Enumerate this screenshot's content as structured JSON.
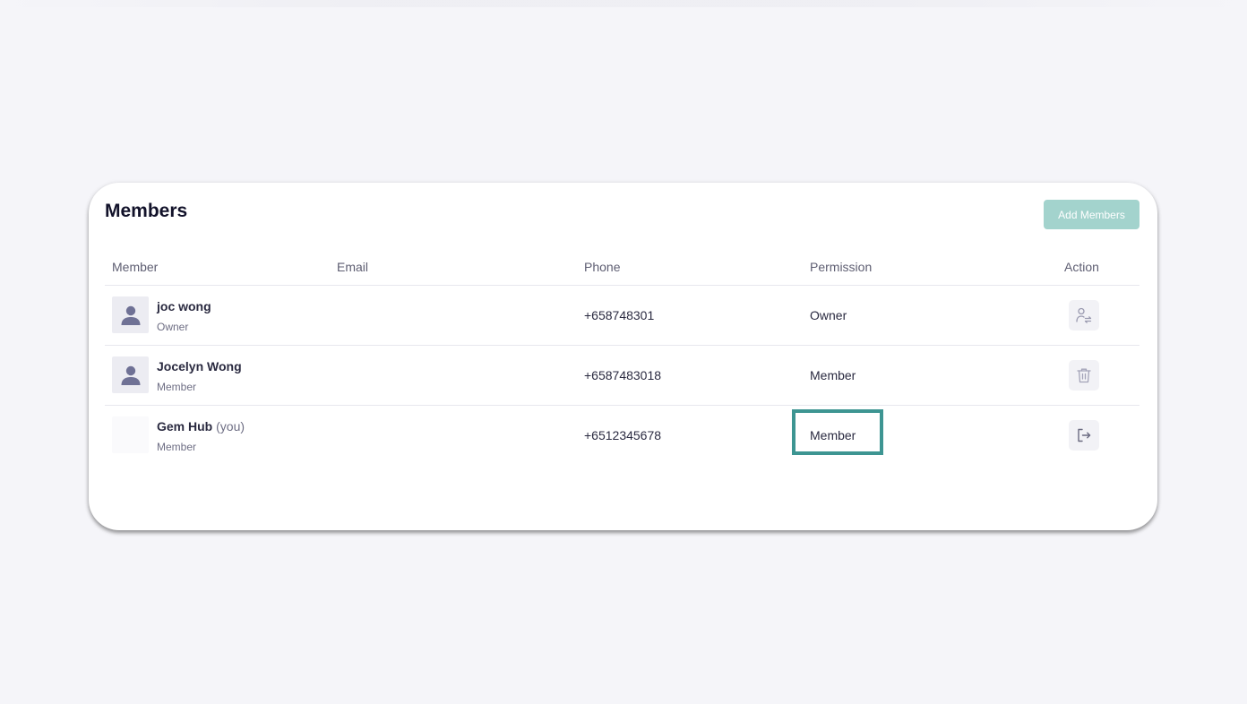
{
  "members_panel": {
    "title": "Members",
    "add_button_label": "Add Members",
    "columns": {
      "member": "Member",
      "email": "Email",
      "phone": "Phone",
      "permission": "Permission",
      "action": "Action"
    },
    "rows": [
      {
        "name": "joc wong",
        "suffix": "",
        "role": "Owner",
        "email": "",
        "phone": "+658748301",
        "permission": "Owner",
        "action_icon": "transfer-ownership-icon"
      },
      {
        "name": "Jocelyn Wong",
        "suffix": "",
        "role": "Member",
        "email": "",
        "phone": "+6587483018",
        "permission": "Member",
        "action_icon": "trash-icon"
      },
      {
        "name": "Gem Hub",
        "suffix": "(you)",
        "role": "Member",
        "email": "",
        "phone": "+6512345678",
        "permission": "Member",
        "action_icon": "leave-icon"
      }
    ]
  },
  "colors": {
    "background": "#f5f5f9",
    "accent_button": "#a3d3cd",
    "highlight_border": "#3d9592",
    "avatar_icon": "#6f7195"
  }
}
